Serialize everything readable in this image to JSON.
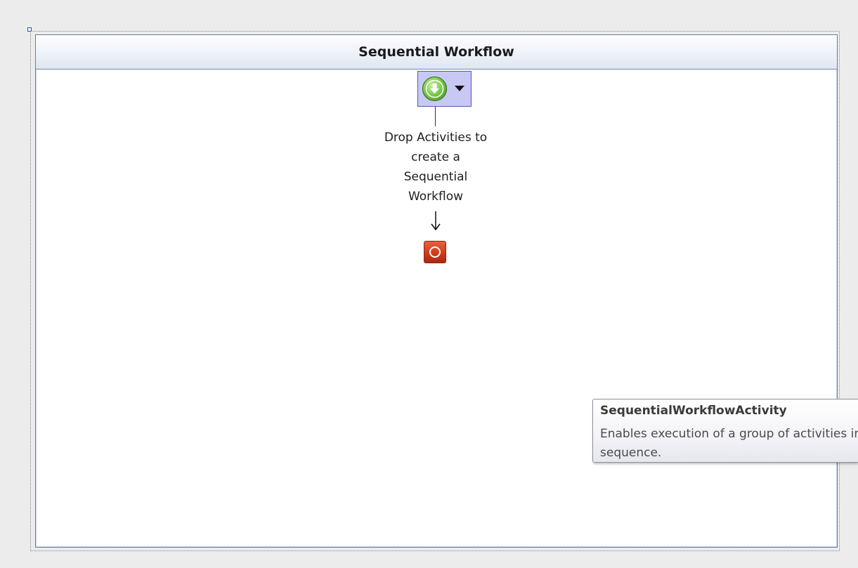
{
  "designer": {
    "title": "Sequential Workflow",
    "start_node": {
      "icon": "green-down-arrow-icon",
      "menu_icon": "chevron-down-icon",
      "fill_color": "#c8c8f5",
      "border_color": "#5757b0"
    },
    "drop_hint": "Drop Activities to\ncreate a\nSequential\nWorkflow",
    "end_node": {
      "icon": "stop-icon",
      "color": "#cc3a1a"
    }
  },
  "tooltip": {
    "title": "SequentialWorkflowActivity",
    "body": "Enables execution of a group of activities in\nsequence."
  },
  "colors": {
    "canvas_bg": "#ececec",
    "header_border": "#6f8fb6",
    "selection_handle": "#2a4fa8"
  }
}
